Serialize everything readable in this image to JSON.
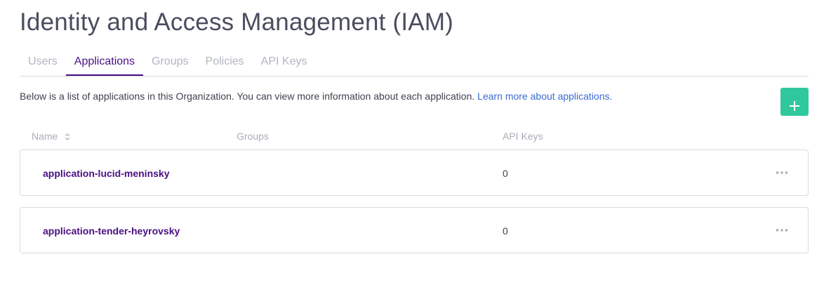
{
  "page": {
    "title": "Identity and Access Management (IAM)"
  },
  "tabs": [
    {
      "label": "Users",
      "active": false
    },
    {
      "label": "Applications",
      "active": true
    },
    {
      "label": "Groups",
      "active": false
    },
    {
      "label": "Policies",
      "active": false
    },
    {
      "label": "API Keys",
      "active": false
    }
  ],
  "description": {
    "text": "Below is a list of applications in this Organization. You can view more information about each application. ",
    "link_text": "Learn more about applications."
  },
  "add_button": {
    "icon": "plus-icon",
    "color": "#2fc89d"
  },
  "table": {
    "columns": [
      "Name",
      "Groups",
      "API Keys"
    ],
    "sort_icon": "sort-icon",
    "rows": [
      {
        "name": "application-lucid-meninsky",
        "groups": "",
        "api_keys": "0",
        "menu_icon": "more-horizontal-icon"
      },
      {
        "name": "application-tender-heyrovsky",
        "groups": "",
        "api_keys": "0",
        "menu_icon": "more-horizontal-icon"
      }
    ]
  },
  "colors": {
    "accent": "#4a0f82",
    "link": "#3a6bd1",
    "success": "#2fc89d"
  }
}
